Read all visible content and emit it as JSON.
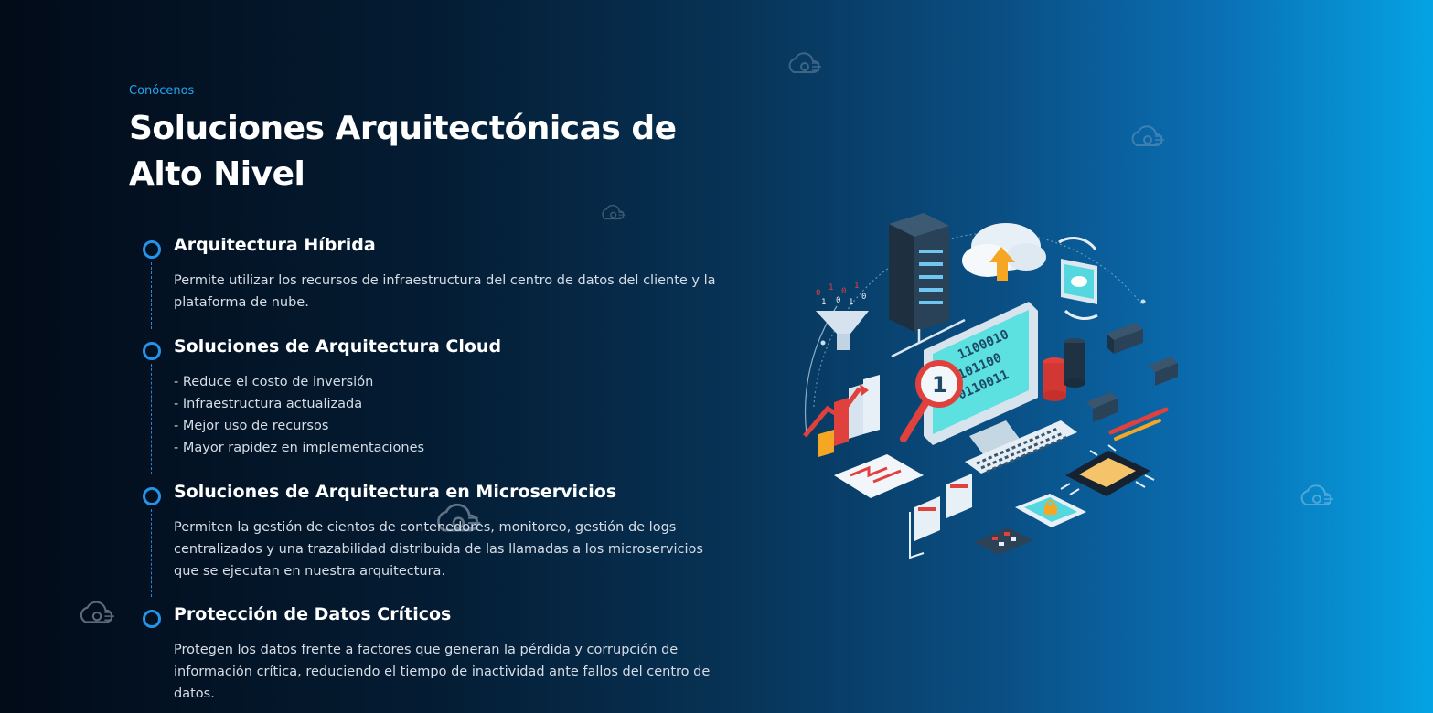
{
  "section": {
    "eyebrow": "Conócenos",
    "title": "Soluciones Arquitectónicas de Alto Nivel"
  },
  "items": [
    {
      "title": "Arquitectura Híbrida",
      "description": "Permite utilizar los recursos de infraestructura del centro de datos del cliente y la plataforma de nube."
    },
    {
      "title": "Soluciones de Arquitectura Cloud",
      "bullets": [
        "- Reduce el costo de inversión",
        "- Infraestructura actualizada",
        "- Mejor uso de recursos",
        "- Mayor rapidez en implementaciones"
      ]
    },
    {
      "title": "Soluciones de Arquitectura en Microservicios",
      "description": "Permiten la gestión de cientos de contenedores, monitoreo, gestión de logs centralizados y una trazabilidad distribuida de las llamadas a los microservicios que se ejecutan en nuestra arquitectura."
    },
    {
      "title": "Protección de Datos Críticos",
      "description": "Protegen los datos frente a factores que generan la pérdida y corrupción de información crítica, reduciendo el tiempo de inactividad ante fallos del centro de datos."
    }
  ],
  "illustration": {
    "screen_digits": [
      "1100010",
      "101100",
      "0110011"
    ],
    "badge_number": "1"
  },
  "colors": {
    "accent": "#2594e8",
    "eyebrow": "#22a6f0",
    "screen": "#5ce0e0",
    "red": "#e0413c",
    "orange": "#f5a623"
  },
  "icons": [
    "cloud-logo-icon",
    "server-icon",
    "cloud-upload-icon",
    "monitor-icon",
    "magnifier-icon",
    "database-icon",
    "bar-chart-icon",
    "keyboard-icon",
    "cpu-chip-icon",
    "phone-lock-icon",
    "calculator-icon",
    "tablet-cloud-icon",
    "funnel-icon",
    "pencil-icon",
    "flowchart-icon",
    "spreadsheet-icon"
  ]
}
